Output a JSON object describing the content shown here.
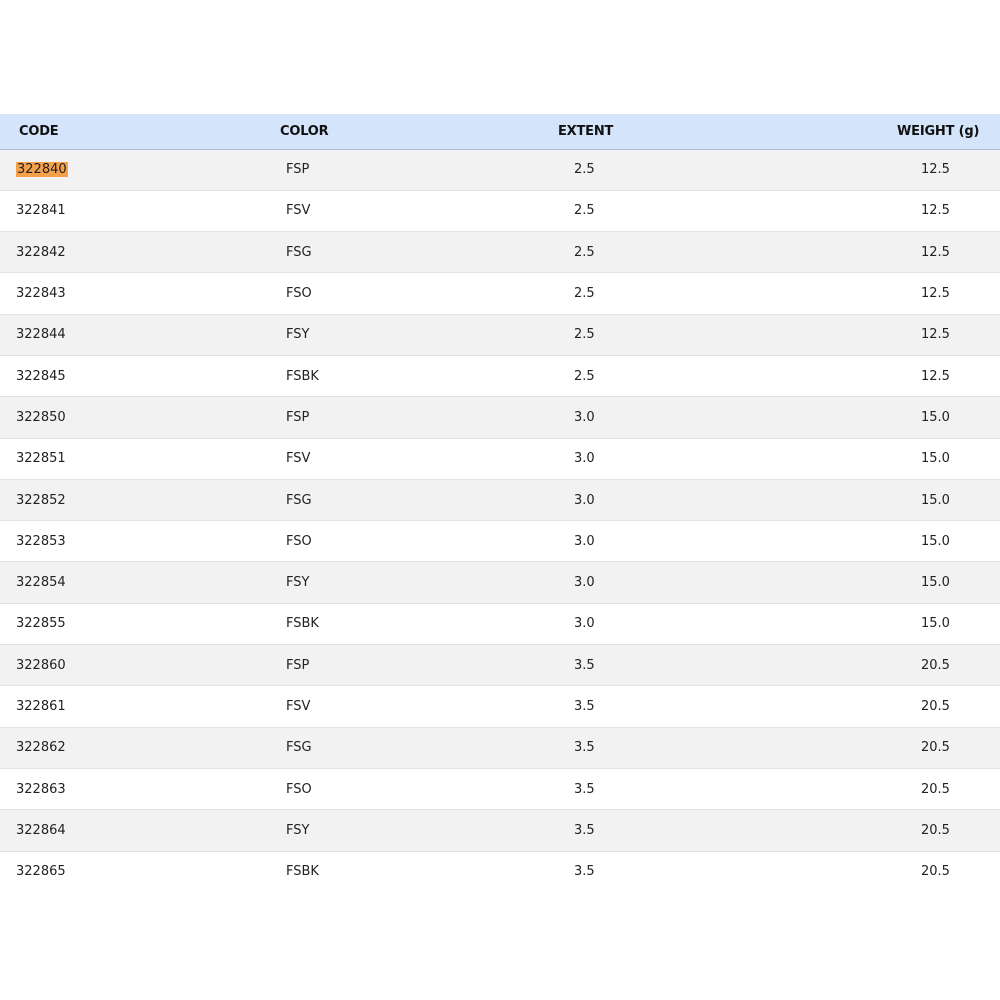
{
  "table": {
    "headers": [
      "CODE",
      "COLOR",
      "EXTENT",
      "WEIGHT (g)"
    ],
    "highlight_color": "#f5a04b",
    "header_background": "#d4e4fb",
    "rows": [
      [
        "322840",
        "FSP",
        "2.5",
        "12.5"
      ],
      [
        "322841",
        "FSV",
        "2.5",
        "12.5"
      ],
      [
        "322842",
        "FSG",
        "2.5",
        "12.5"
      ],
      [
        "322843",
        "FSO",
        "2.5",
        "12.5"
      ],
      [
        "322844",
        "FSY",
        "2.5",
        "12.5"
      ],
      [
        "322845",
        "FSBK",
        "2.5",
        "12.5"
      ],
      [
        "322850",
        "FSP",
        "3.0",
        "15.0"
      ],
      [
        "322851",
        "FSV",
        "3.0",
        "15.0"
      ],
      [
        "322852",
        "FSG",
        "3.0",
        "15.0"
      ],
      [
        "322853",
        "FSO",
        "3.0",
        "15.0"
      ],
      [
        "322854",
        "FSY",
        "3.0",
        "15.0"
      ],
      [
        "322855",
        "FSBK",
        "3.0",
        "15.0"
      ],
      [
        "322860",
        "FSP",
        "3.5",
        "20.5"
      ],
      [
        "322861",
        "FSV",
        "3.5",
        "20.5"
      ],
      [
        "322862",
        "FSG",
        "3.5",
        "20.5"
      ],
      [
        "322863",
        "FSO",
        "3.5",
        "20.5"
      ],
      [
        "322864",
        "FSY",
        "3.5",
        "20.5"
      ],
      [
        "322865",
        "FSBK",
        "3.5",
        "20.5"
      ]
    ]
  }
}
